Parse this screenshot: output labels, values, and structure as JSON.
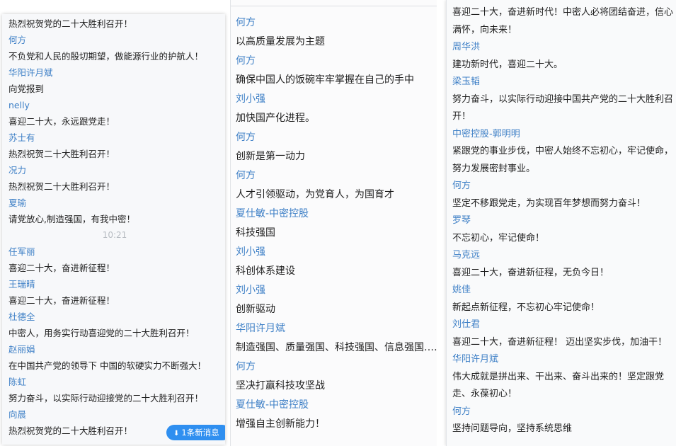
{
  "panel1": {
    "messages": [
      {
        "text": "热烈祝贺党的二十大胜利召开！"
      },
      {
        "name": "何方",
        "text": "不负党和人民的殷切期望，做能源行业的护航人！"
      },
      {
        "name": "华阳许月斌",
        "text": "向党报到"
      },
      {
        "name": "nelly",
        "text": "喜迎二十大，永远跟党走！"
      },
      {
        "name": "苏士有",
        "text": "热烈祝贺二十大胜利召开！"
      },
      {
        "name": "况力",
        "text": "热烈祝贺二十大胜利召开！"
      },
      {
        "name": "夏瑜",
        "text": "请党放心,制造强国，有我中密！"
      }
    ],
    "time": "10:21",
    "messages2": [
      {
        "name": "任军丽",
        "text": "喜迎二十大，奋进新征程！"
      },
      {
        "name": "王瑞晴",
        "text": "喜迎二十大，奋进新征程！"
      },
      {
        "name": "杜德全",
        "text": "中密人，用务实行动喜迎党的二十大胜利召开！"
      },
      {
        "name": "赵丽娟",
        "text": "在中国共产党的领导下 中国的软硬实力不断强大！"
      },
      {
        "name": "陈虹",
        "text": "努力奋斗，以实际行动迎接党的二十大胜利召开！"
      },
      {
        "name": "向晨",
        "text": "热烈祝贺党的二十大胜利召开！"
      }
    ],
    "new_message_label": "1条新消息",
    "new_message_icon": "double-chevron-down-icon"
  },
  "panel2": {
    "messages": [
      {
        "name": "何方",
        "text": "以高质量发展为主题"
      },
      {
        "name": "何方",
        "text": "确保中国人的饭碗牢牢掌握在自己的手中"
      },
      {
        "name": "刘小强",
        "text": "加快国产化进程。"
      },
      {
        "name": "何方",
        "text": "创新是第一动力"
      },
      {
        "name": "何方",
        "text": "人才引领驱动，为党育人，为国育才"
      },
      {
        "name": "夏仕敏-中密控股",
        "text": "科技强国"
      },
      {
        "name": "刘小强",
        "text": "科创体系建设"
      },
      {
        "name": "刘小强",
        "text": "创新驱动"
      },
      {
        "name": "华阳许月斌",
        "text": "制造强国、质量强国、科技强国、信息强国……"
      },
      {
        "name": "何方",
        "text": "坚决打赢科技攻坚战"
      },
      {
        "name": "夏仕敏-中密控股",
        "text": "增强自主创新能力！"
      }
    ]
  },
  "panel3": {
    "messages": [
      {
        "text": "喜迎二十大，奋进新时代！中密人必将团结奋进，信心满怀，向未来！"
      },
      {
        "name": "周华洪",
        "text": "建功新时代，喜迎二十大。"
      },
      {
        "name": "梁玉韬",
        "text": "努力奋斗，以实际行动迎接中国共产党的二十大胜利召开！"
      },
      {
        "name": "中密控股-郭明明",
        "text": "紧跟党的事业步伐，中密人始终不忘初心，牢记使命，努力发展密封事业。"
      },
      {
        "name": "何方",
        "text": "坚定不移跟党走，为实现百年梦想而努力奋斗！"
      },
      {
        "name": "罗琴",
        "text": "不忘初心，牢记使命！"
      },
      {
        "name": "马克远",
        "text": "喜迎二十大，奋进新征程，无负今日！"
      },
      {
        "name": "姚佳",
        "text": "新起点新征程，不忘初心牢记使命！"
      },
      {
        "name": "刘仕君",
        "text": "喜迎二十大，奋进新征程！ 迈出坚实步伐，加油干！"
      },
      {
        "name": "华阳许月斌",
        "text": "伟大成就是拼出来、干出来、奋斗出来的！坚定跟党走、永葆初心！"
      },
      {
        "name": "何方",
        "text": "坚持问题导向，坚持系统思维"
      }
    ]
  }
}
